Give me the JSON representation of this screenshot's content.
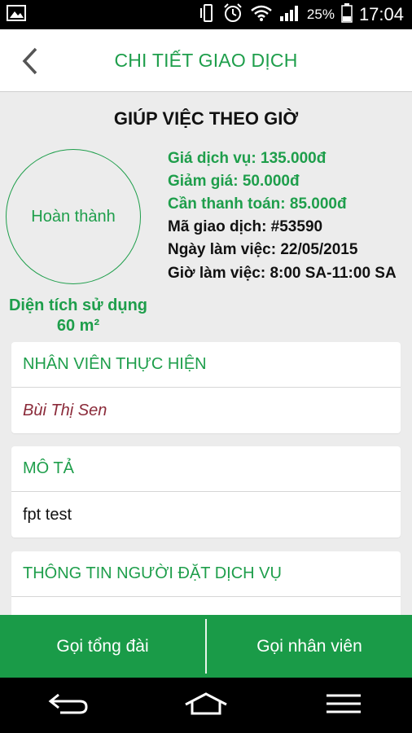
{
  "status_bar": {
    "battery_percent": "25%",
    "time": "17:04",
    "icons": [
      "image-icon",
      "phone-vibrate-icon",
      "alarm-icon",
      "wifi-icon",
      "signal-icon",
      "battery-icon"
    ]
  },
  "header": {
    "title": "CHI TIẾT GIAO DỊCH",
    "back_icon": "back-arrow-icon"
  },
  "service": {
    "title": "GIÚP VIỆC THEO GIỜ",
    "status": "Hoàn thành",
    "area_label": "Diện tích sử dụng",
    "area_value": "60 m²"
  },
  "details": {
    "service_price": "Giá dịch vụ: 135.000đ",
    "discount": "Giảm giá: 50.000đ",
    "to_pay": "Cần thanh toán: 85.000đ",
    "transaction_id": "Mã giao dịch: #53590",
    "work_date": "Ngày làm việc: 22/05/2015",
    "work_time": "Giờ làm việc: 8:00 SA-11:00 SA"
  },
  "cards": {
    "staff": {
      "header": "NHÂN VIÊN THỰC HIỆN",
      "value": "Bùi Thị Sen"
    },
    "description": {
      "header": "MÔ TẢ",
      "value": "fpt test"
    },
    "booker": {
      "header": "THÔNG TIN NGƯỜI ĐẶT DỊCH VỤ"
    }
  },
  "actions": {
    "call_hotline": "Gọi tổng đài",
    "call_staff": "Gọi nhân viên"
  },
  "colors": {
    "accent": "#1e9e4b",
    "bottom_bar": "#1a9b48",
    "staff_name": "#8b2b3a"
  },
  "nav_icons": [
    "back-icon",
    "home-icon",
    "menu-icon"
  ]
}
